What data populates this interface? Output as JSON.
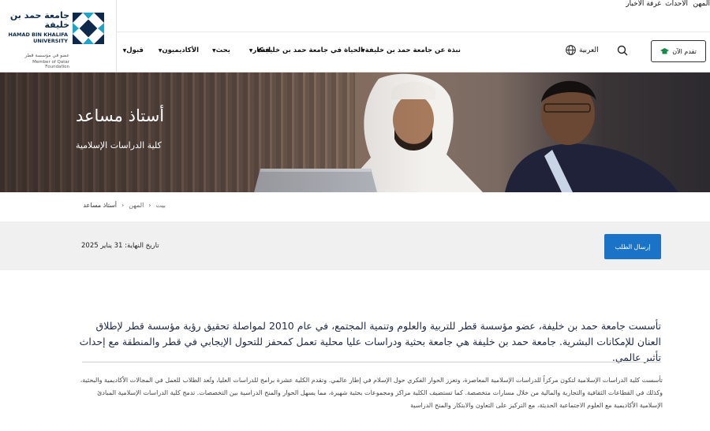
{
  "logo": {
    "name_ar": "جامعة حمد بن خليفة",
    "name_en": "HAMAD BIN KHALIFA UNIVERSITY",
    "member_ar": "عضو في مؤسسة قطر",
    "member_en": "Member of Qatar Foundation"
  },
  "top_links": [
    "المهن",
    "الأحداث",
    "غرفة الأخبار"
  ],
  "nav": {
    "apply_label": "تقدم الآن",
    "language_label": "العربية",
    "items": [
      "نبذة عن جامعة حمد بن خليفة",
      "الحياة في جامعة حمد بن خليفة",
      "ابتكار",
      "بحث",
      "الأكاديميون",
      "قبول"
    ]
  },
  "hero": {
    "title": "أستاذ مساعد",
    "subtitle": "كلية الدراسات الإسلامية"
  },
  "breadcrumb": [
    "بيت",
    "المهن",
    "أستاذ مساعد"
  ],
  "info_bar": {
    "deadline": "تاريخ النهاية: 31 يناير 2025",
    "submit_label": "إرسال الطلب"
  },
  "content": {
    "intro": "تأسست جامعة حمد بن خليفة، عضو مؤسسة قطر للتربية والعلوم وتنمية المجتمع، في عام 2010 لمواصلة تحقيق رؤية مؤسسة قطر لإطلاق العنان للإمكانات البشرية. جامعة حمد بن خليفة هي جامعة بحثية ودراسات عليا محلية تعمل كمحفز للتحول الإيجابي في قطر والمنطقة مع إحداث تأثير عالمي.",
    "body": "تأسست كلية الدراسات الإسلامية لتكون مركزاً للدراسات الإسلامية المعاصرة، وتعزز الحوار الفكري حول الإسلام في إطار عالمي. وتقدم الكلية عشرة برامج للدراسات العليا، وتُعد الطلاب للعمل في المجالات الأكاديمية والبحثية، وكذلك في القطاعات الثقافية والتجارية والمالية من خلال مسارات متخصصة. كما تستضيف الكلية مراكز ومجموعات بحثية شهيرة، مما يسهل الحوار والمنح الدراسية بين التخصصات. تدمج كلية الدراسات الإسلامية المبادئ الإسلامية الأكاديمية مع العلوم الاجتماعية الحديثة، مع التركيز على التعاون والابتكار والمنح الدراسية"
  },
  "colors": {
    "brand_navy": "#0d2a4c",
    "brand_cyan": "#1fa3c9",
    "submit_blue": "#1a73c6"
  }
}
